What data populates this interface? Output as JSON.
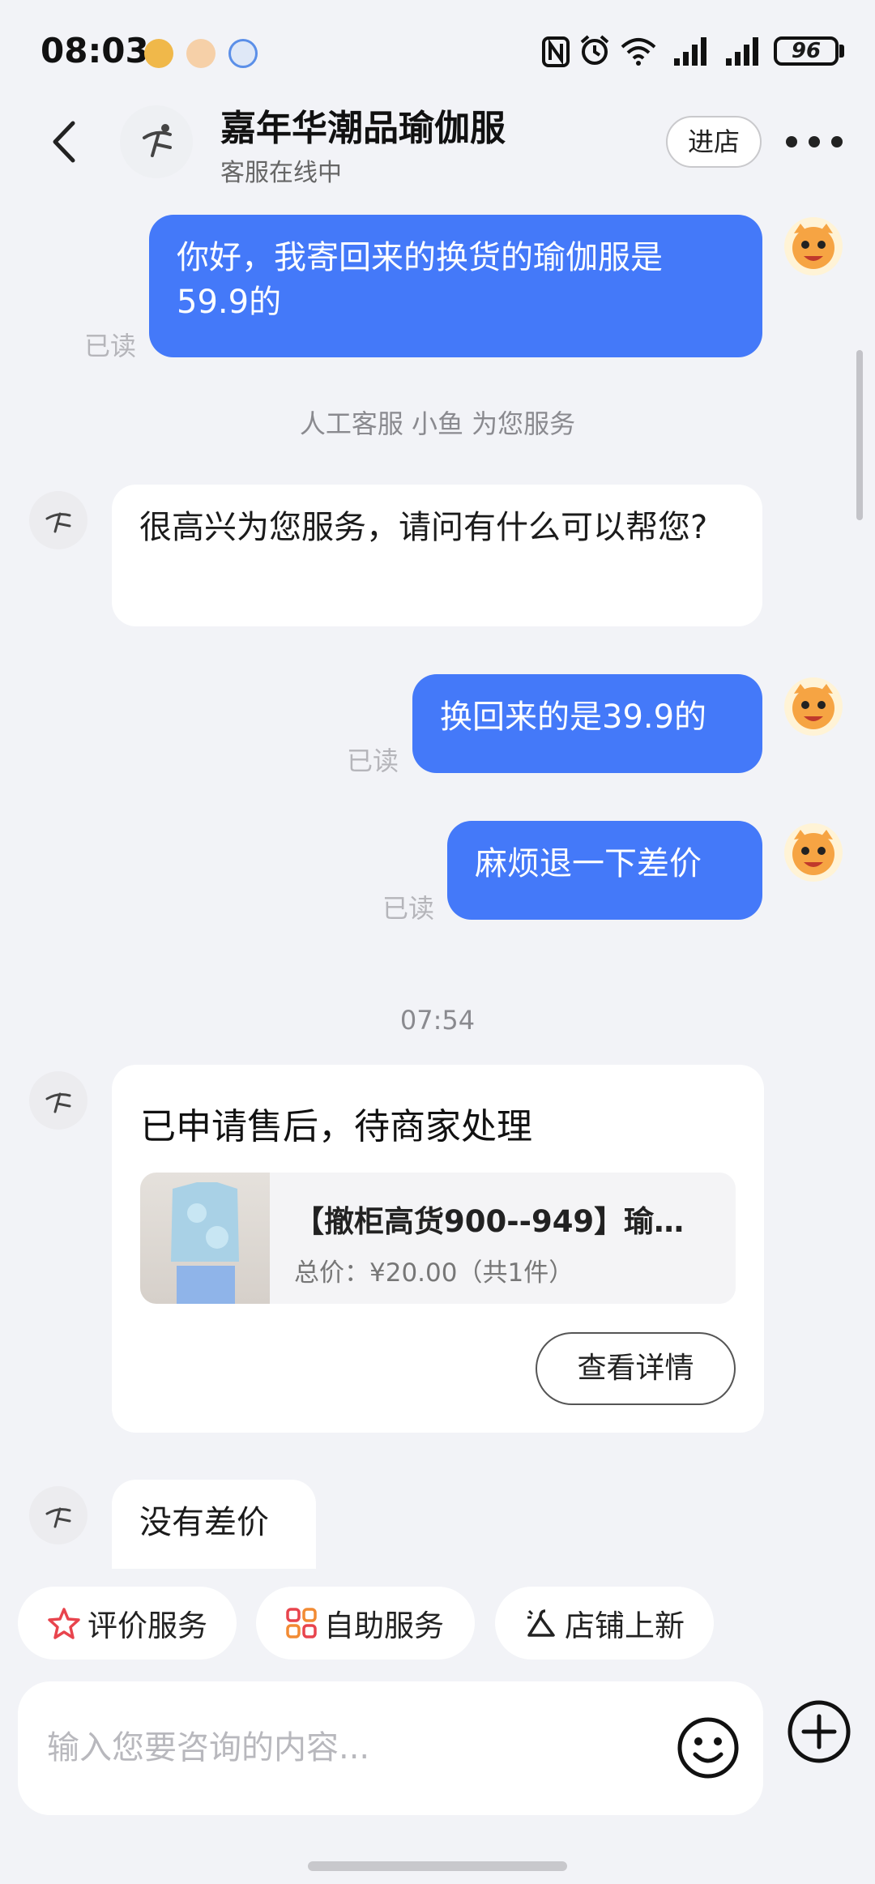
{
  "status_bar": {
    "time": "08:03",
    "battery": "96"
  },
  "header": {
    "shop_name": "嘉年华潮品瑜伽服",
    "status": "客服在线中",
    "enter_label": "进店"
  },
  "messages": {
    "m1": "你好，我寄回来的换货的瑜伽服是59.9的",
    "read_label": "已读",
    "system": "人工客服 小鱼 为您服务",
    "m2": "很高兴为您服务，请问有什么可以帮您?",
    "m3": "换回来的是39.9的",
    "m4": "麻烦退一下差价",
    "time": "07:54",
    "m5": "没有差价"
  },
  "card": {
    "title": "已申请售后，待商家处理",
    "product_name": "【撤柜高货900--949】瑜…",
    "product_price": "总价：¥20.00（共1件）",
    "detail_label": "查看详情"
  },
  "quick_actions": {
    "rate": "评价服务",
    "self": "自助服务",
    "new": "店铺上新"
  },
  "input": {
    "placeholder": "输入您要咨询的内容..."
  },
  "colors": {
    "accent": "#4479f9",
    "background": "#f2f3f7"
  }
}
